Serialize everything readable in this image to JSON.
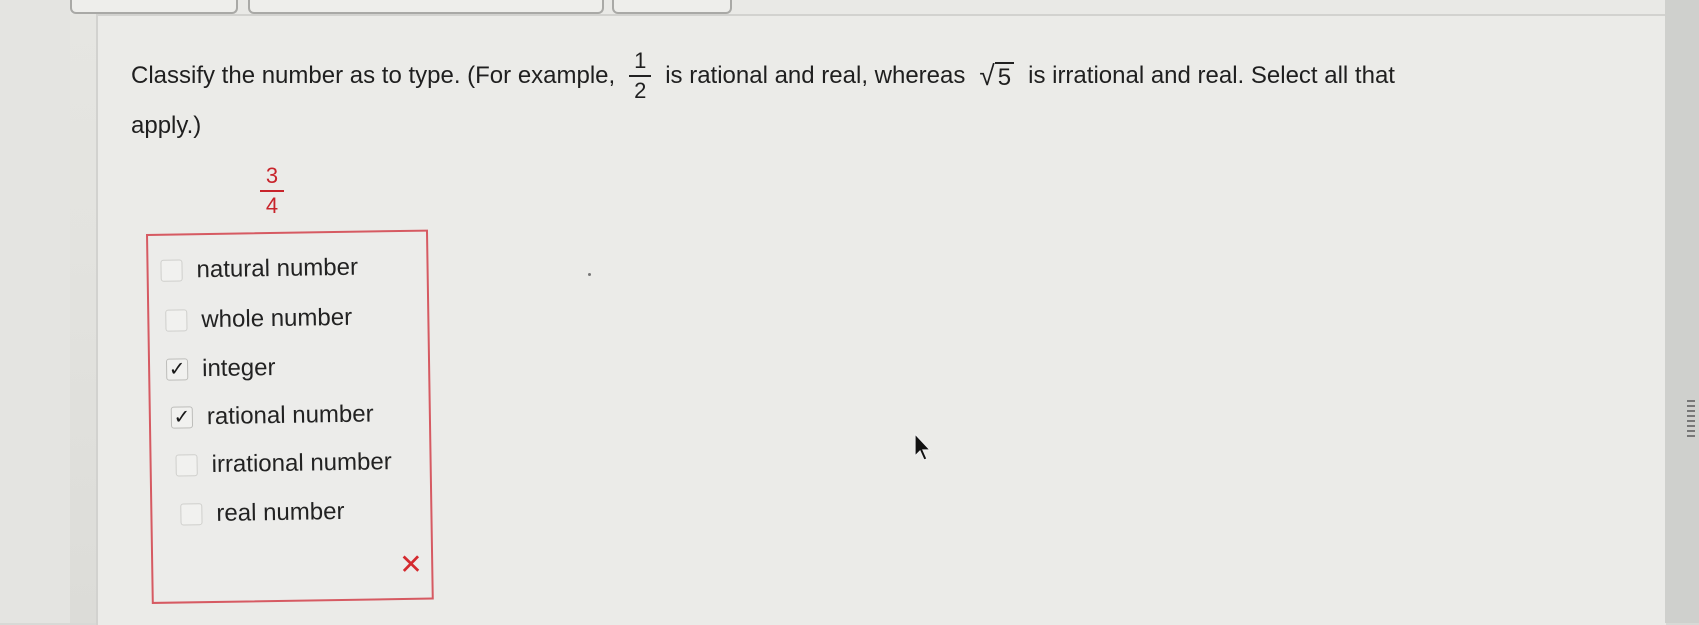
{
  "question": {
    "prefix": "Classify the number as to type. (For example,",
    "example1": {
      "numerator": "1",
      "denominator": "2"
    },
    "middle": "is rational and real, whereas",
    "example2": {
      "radical": "√",
      "radicand": "5"
    },
    "suffix": "is irrational and real. Select all that",
    "line2": "apply.)"
  },
  "target_number": {
    "numerator": "3",
    "denominator": "4"
  },
  "options": [
    {
      "label": "natural number",
      "checked": false
    },
    {
      "label": "whole number",
      "checked": false
    },
    {
      "label": "integer",
      "checked": true
    },
    {
      "label": "rational number",
      "checked": true
    },
    {
      "label": "irrational number",
      "checked": false
    },
    {
      "label": "real number",
      "checked": false
    }
  ],
  "checkmark_glyph": "✓",
  "result": {
    "icon": "incorrect-x-icon",
    "glyph": "✕",
    "color": "#d42a2f"
  },
  "colors": {
    "target": "#c8242b",
    "box_border": "#d65a62"
  }
}
